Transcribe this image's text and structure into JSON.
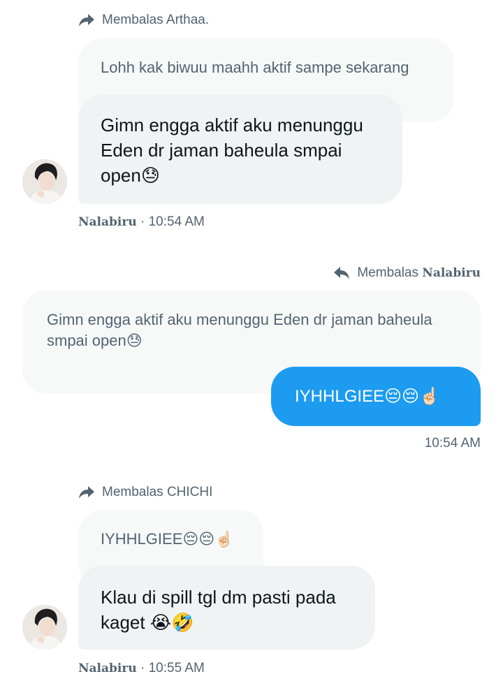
{
  "messages": [
    {
      "reply_prefix": "Membalas",
      "reply_to": "Arthaa.",
      "quoted_text": "Lohh kak biwuu maahh aktif sampe sekarang",
      "text": "Gimn engga aktif aku menunggu Eden dr jaman baheula smpai open😓",
      "sender": "Nalabiru",
      "separator": "·",
      "time": "10:54 AM"
    },
    {
      "reply_prefix": "Membalas",
      "reply_to": "Nalabiru",
      "quoted_text": "Gimn engga aktif aku menunggu Eden dr jaman baheula smpai open😓",
      "text": "IYHHLGIEE😔😔☝🏻",
      "time": "10:54 AM"
    },
    {
      "reply_prefix": "Membalas",
      "reply_to": "CHICHI",
      "quoted_text": "IYHHLGIEE😔😔☝🏻",
      "text": "Klau di spill tgl dm pasti pada kaget 😭🤣",
      "sender": "Nalabiru",
      "separator": "·",
      "time": "10:55 AM"
    }
  ],
  "icons": {
    "reply_forward": "reply-forward-icon",
    "reply_back": "reply-back-icon",
    "avatar": "avatar-portrait"
  },
  "colors": {
    "accent": "#1d9bf0",
    "muted_text": "#536471",
    "incoming_bubble": "#eff3f4",
    "quoted_bubble": "#f7f9f9"
  }
}
